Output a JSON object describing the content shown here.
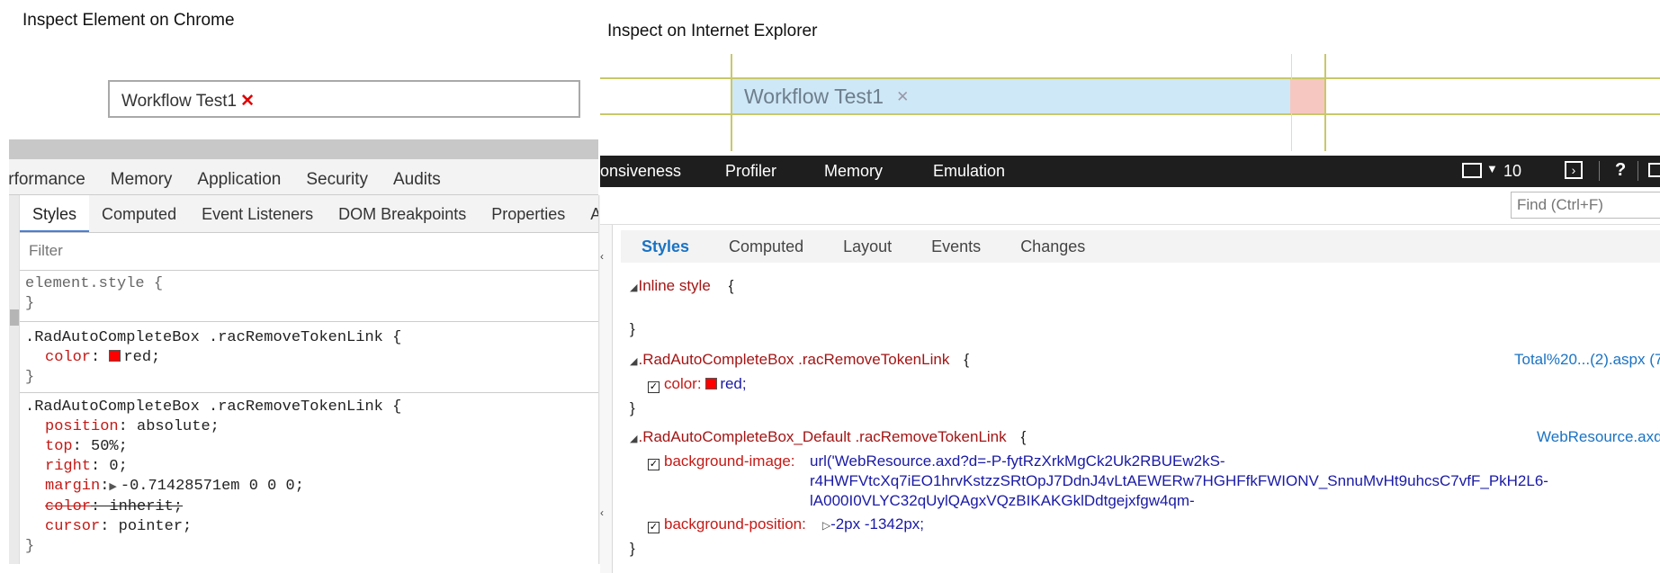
{
  "chrome": {
    "caption": "Inspect Element on Chrome",
    "token_text": "Workflow Test1",
    "token_remove": "✕",
    "tabs": [
      "Performance",
      "Memory",
      "Application",
      "Security",
      "Audits"
    ],
    "subtabs": [
      "Styles",
      "Computed",
      "Event Listeners",
      "DOM Breakpoints",
      "Properties",
      "A"
    ],
    "filter_placeholder": "Filter",
    "rule1": {
      "selector": "element.style {",
      "close": "}"
    },
    "rule2": {
      "selector": ".RadAutoCompleteBox .racRemoveTokenLink {",
      "prop": "color",
      "value": "red;",
      "close": "}"
    },
    "rule3": {
      "selector": ".RadAutoCompleteBox .racRemoveTokenLink {",
      "props": [
        {
          "name": "position",
          "value": "absolute;"
        },
        {
          "name": "top",
          "value": "50%;"
        },
        {
          "name": "right",
          "value": "0;"
        },
        {
          "name": "margin",
          "value": "-0.71428571em 0 0 0;"
        },
        {
          "name": "color",
          "value": "inherit;"
        },
        {
          "name": "cursor",
          "value": "pointer;"
        }
      ],
      "close": "}"
    }
  },
  "ie": {
    "caption": "Inspect on Internet Explorer",
    "token_text": "Workflow Test1",
    "token_remove": "✕",
    "topbar": {
      "responsiveness": "onsiveness",
      "profiler": "Profiler",
      "memory": "Memory",
      "emulation": "Emulation",
      "doc_mode": "10",
      "help": "?"
    },
    "find_placeholder": "Find (Ctrl+F)",
    "subtabs": [
      "Styles",
      "Computed",
      "Layout",
      "Events",
      "Changes"
    ],
    "inline_style": "Inline style",
    "open_brace": "{",
    "close_brace": "}",
    "rule1": {
      "selector": ".RadAutoCompleteBox .racRemoveTokenLink",
      "source": "Total%20...(2).aspx (7",
      "prop": "color:",
      "value": "red;"
    },
    "rule2": {
      "selector": ".RadAutoCompleteBox_Default .racRemoveTokenLink",
      "source": "WebResource.axd",
      "prop1": "background-image:",
      "value1_line1": "url('WebResource.axd?d=-P-fytRzXrkMgCk2Uk2RBUEw2kS-",
      "value1_line2": "r4HWFVtcXq7iEO1hrvKstzzSRtOpJ7DdnJ4vLtAEWERw7HGHFfkFWIONV_SnnuMvHt9uhcsC7vfF_PkH2L6-",
      "value1_line3": "lA000I0VLYC32qUylQAgxVQzBIKAKGklDdtgejxfgw4qm-",
      "prop2": "background-position:",
      "value2": "-2px -1342px;"
    }
  },
  "colors": {
    "swatch": "#ff0000",
    "ie_token_bg": "#cfe8f7",
    "ie_active_tab": "#1a73c4"
  }
}
